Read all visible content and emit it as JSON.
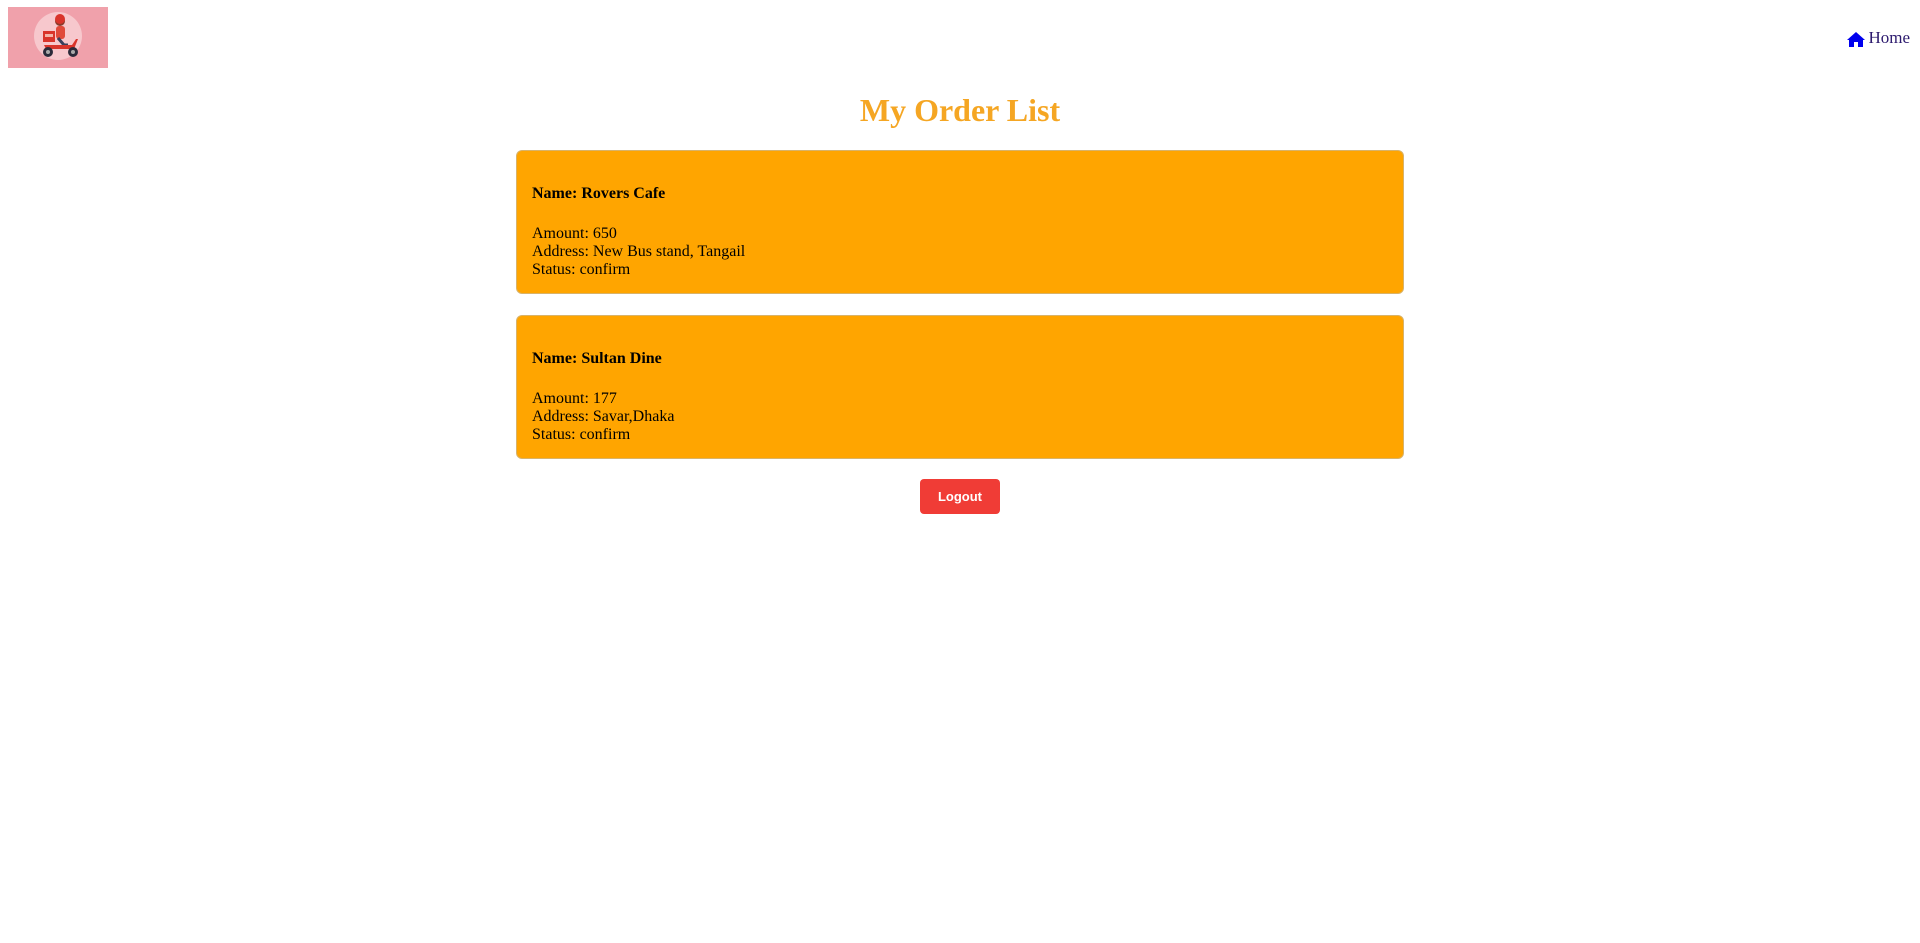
{
  "header": {
    "logo_icon": "delivery-scooter-logo",
    "nav": {
      "home_icon": "home-icon",
      "home_label": "Home"
    }
  },
  "main": {
    "title": "My Order List",
    "orders": [
      {
        "name": "Name: Rovers Cafe",
        "amount": "Amount: 650",
        "address": "Address: New Bus stand, Tangail",
        "status": "Status: confirm"
      },
      {
        "name": "Name: Sultan Dine",
        "amount": "Amount: 177",
        "address": "Address: Savar,Dhaka",
        "status": "Status: confirm"
      }
    ],
    "logout_label": "Logout"
  },
  "colors": {
    "title": "#f5a623",
    "card_bg": "#ffa500",
    "logout_bg": "#f03c36",
    "logo_bg": "#f0a1ab",
    "home_icon": "#0000ee"
  }
}
